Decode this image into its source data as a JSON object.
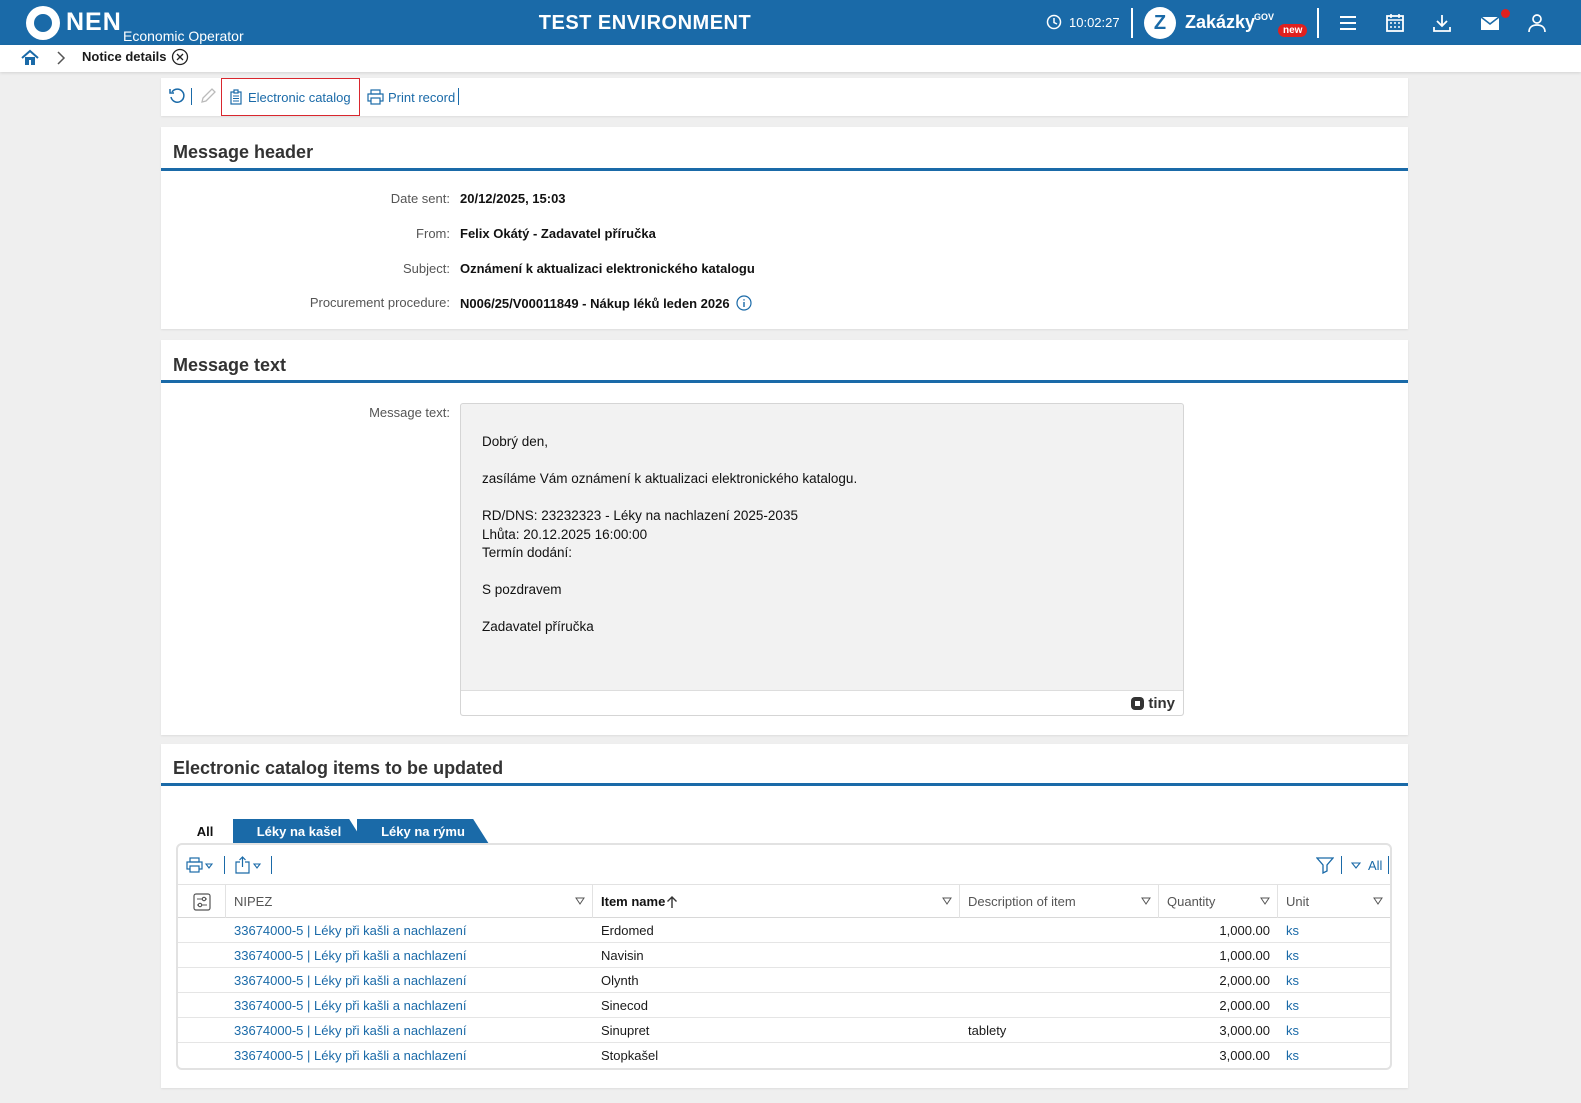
{
  "topbar": {
    "brand": "NEN",
    "brand_sub": "Economic Operator",
    "env_title": "TEST ENVIRONMENT",
    "clock": "10:02:27",
    "zakazky": "Zakázky",
    "gov": "GOV",
    "new_badge": "new"
  },
  "breadcrumb": {
    "title": "Notice details"
  },
  "toolbar": {
    "electronic_catalog": "Electronic catalog",
    "print_record": "Print record"
  },
  "header_card": {
    "title": "Message header",
    "fields": [
      {
        "label": "Date sent:",
        "value": "20/12/2025, 15:03"
      },
      {
        "label": "From:",
        "value": "Felix Okátý - Zadavatel příručka"
      },
      {
        "label": "Subject:",
        "value": "Oznámení k aktualizaci elektronického katalogu"
      },
      {
        "label": "Procurement procedure:",
        "value": "N006/25/V00011849 - Nákup léků leden 2026"
      }
    ]
  },
  "text_card": {
    "title": "Message text",
    "label": "Message text:",
    "lines": [
      "Dobrý den,",
      "",
      "zasíláme Vám oznámení k aktualizaci elektronického katalogu.",
      "",
      "RD/DNS: 23232323 - Léky na nachlazení 2025-2035",
      "Lhůta: 20.12.2025 16:00:00",
      "Termín dodání:",
      "",
      "S pozdravem",
      "",
      "Zadavatel příručka"
    ],
    "editor_brand": "tiny"
  },
  "catalog_card": {
    "title": "Electronic catalog items to be updated",
    "tabs": [
      "All",
      "Léky na kašel",
      "Léky na rýmu"
    ],
    "filter_all": "All",
    "columns": [
      "NIPEZ",
      "Item name",
      "Description of item",
      "Quantity",
      "Unit"
    ],
    "rows": [
      {
        "nipez": "33674000-5 | Léky při kašli a nachlazení",
        "item": "Erdomed",
        "desc": "",
        "qty": "1,000.00",
        "unit": "ks"
      },
      {
        "nipez": "33674000-5 | Léky při kašli a nachlazení",
        "item": "Navisin",
        "desc": "",
        "qty": "1,000.00",
        "unit": "ks"
      },
      {
        "nipez": "33674000-5 | Léky při kašli a nachlazení",
        "item": "Olynth",
        "desc": "",
        "qty": "2,000.00",
        "unit": "ks"
      },
      {
        "nipez": "33674000-5 | Léky při kašli a nachlazení",
        "item": "Sinecod",
        "desc": "",
        "qty": "2,000.00",
        "unit": "ks"
      },
      {
        "nipez": "33674000-5 | Léky při kašli a nachlazení",
        "item": "Sinupret",
        "desc": "tablety",
        "qty": "3,000.00",
        "unit": "ks"
      },
      {
        "nipez": "33674000-5 | Léky při kašli a nachlazení",
        "item": "Stopkašel",
        "desc": "",
        "qty": "3,000.00",
        "unit": "ks"
      }
    ]
  },
  "colors": {
    "primary": "#1a6aa8",
    "alert": "#e0201e",
    "highlight_border": "#d9272e"
  }
}
